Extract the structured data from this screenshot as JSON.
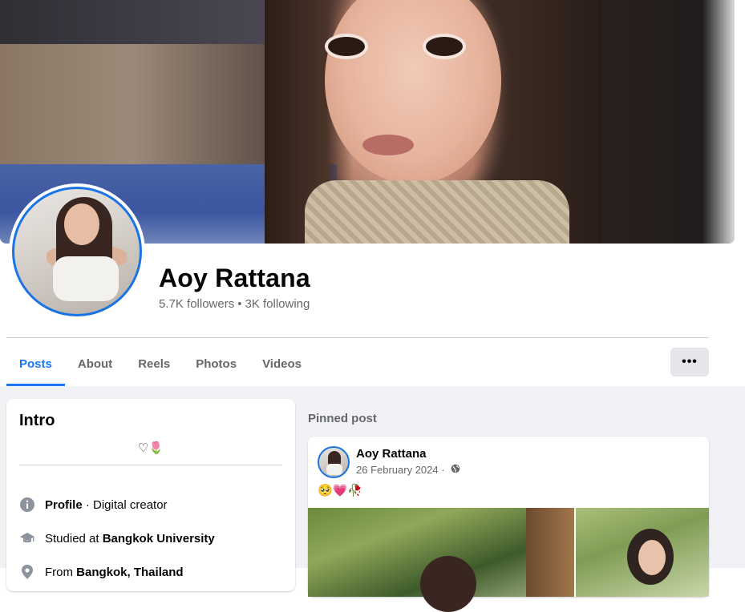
{
  "profile": {
    "name": "Aoy Rattana",
    "followers": "5.7K followers",
    "separator": "•",
    "following": "3K following"
  },
  "tabs": [
    {
      "label": "Posts",
      "active": true
    },
    {
      "label": "About",
      "active": false
    },
    {
      "label": "Reels",
      "active": false
    },
    {
      "label": "Photos",
      "active": false
    },
    {
      "label": "Videos",
      "active": false
    }
  ],
  "more_button": {
    "label": "•••"
  },
  "intro": {
    "title": "Intro",
    "bio": "♡🌷",
    "rows": [
      {
        "icon": "info-icon",
        "bold_prefix": "Profile",
        "text": " · Digital creator"
      },
      {
        "icon": "graduation-cap-icon",
        "prefix": "Studied at ",
        "bold": "Bangkok University"
      },
      {
        "icon": "location-pin-icon",
        "prefix": "From ",
        "bold": "Bangkok, Thailand"
      }
    ]
  },
  "pinned": {
    "label": "Pinned post",
    "author": "Aoy Rattana",
    "date": "26 February 2024",
    "date_sep": " · ",
    "privacy_icon": "globe-icon",
    "text": "🥺💗🥀"
  },
  "colors": {
    "accent": "#1877f2",
    "avatar_ring": "#1b74e4",
    "secondary_text": "#65676b",
    "background": "#f0f2f5"
  }
}
